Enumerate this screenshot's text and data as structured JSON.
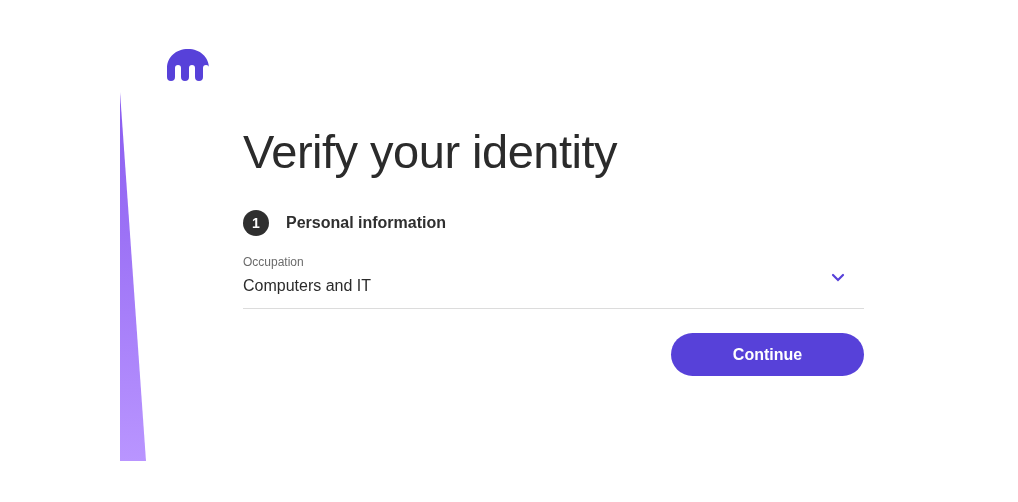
{
  "title": "Verify your identity",
  "step": {
    "number": "1",
    "label": "Personal information"
  },
  "field": {
    "label": "Occupation",
    "value": "Computers and IT"
  },
  "button": "Continue"
}
